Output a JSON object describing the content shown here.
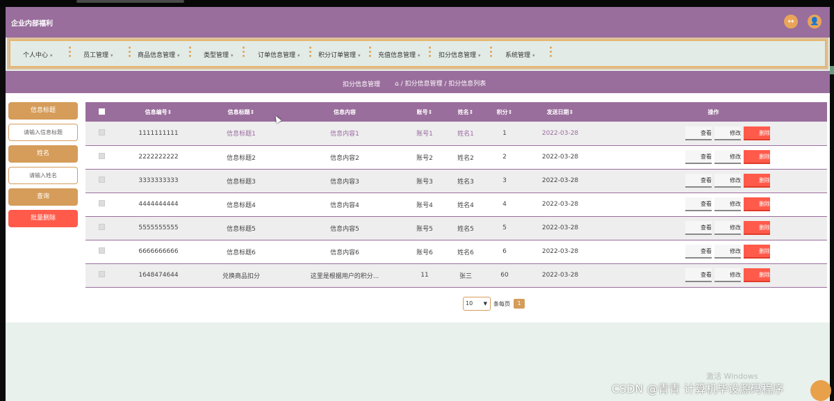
{
  "app": {
    "title": "企业内部福利"
  },
  "header_icons": {
    "expand": "↔",
    "user": "👤"
  },
  "nav": [
    {
      "label": "个人中心"
    },
    {
      "label": "员工管理"
    },
    {
      "label": "商品信息管理"
    },
    {
      "label": "类型管理"
    },
    {
      "label": "订单信息管理"
    },
    {
      "label": "积分订单管理"
    },
    {
      "label": "充值信息管理"
    },
    {
      "label": "扣分信息管理"
    },
    {
      "label": "系统管理"
    }
  ],
  "breadcrumb": {
    "current": "扣分信息管理",
    "trail": "⌂ / 扣分信息管理 / 扣分信息列表"
  },
  "search": {
    "title_label": "信息标题",
    "title_placeholder": "请输入信息标题",
    "name_label": "姓名",
    "name_placeholder": "请输入姓名",
    "query_button": "查询",
    "batch_delete_button": "批量删除"
  },
  "table": {
    "headers": [
      "信息编号⇕",
      "信息标题⇕",
      "信息内容",
      "账号⇕",
      "姓名⇕",
      "积分⇕",
      "发送日期⇕",
      "操作"
    ],
    "rows": [
      {
        "id": "1111111111",
        "title": "信息标题1",
        "content": "信息内容1",
        "account": "账号1",
        "name": "姓名1",
        "points": "1",
        "date": "2022-03-28"
      },
      {
        "id": "2222222222",
        "title": "信息标题2",
        "content": "信息内容2",
        "account": "账号2",
        "name": "姓名2",
        "points": "2",
        "date": "2022-03-28"
      },
      {
        "id": "3333333333",
        "title": "信息标题3",
        "content": "信息内容3",
        "account": "账号3",
        "name": "姓名3",
        "points": "3",
        "date": "2022-03-28"
      },
      {
        "id": "4444444444",
        "title": "信息标题4",
        "content": "信息内容4",
        "account": "账号4",
        "name": "姓名4",
        "points": "4",
        "date": "2022-03-28"
      },
      {
        "id": "5555555555",
        "title": "信息标题5",
        "content": "信息内容5",
        "account": "账号5",
        "name": "姓名5",
        "points": "5",
        "date": "2022-03-28"
      },
      {
        "id": "6666666666",
        "title": "信息标题6",
        "content": "信息内容6",
        "account": "账号6",
        "name": "姓名6",
        "points": "6",
        "date": "2022-03-28"
      },
      {
        "id": "1648474644",
        "title": "兑换商品扣分",
        "content": "这里是根据用户的积分...",
        "account": "11",
        "name": "张三",
        "points": "60",
        "date": "2022-03-28"
      }
    ],
    "actions": {
      "view": "查看",
      "edit": "修改",
      "delete": "删除"
    }
  },
  "pagination": {
    "page_size": "10",
    "per_page_label": "条每页",
    "current_page": "1"
  },
  "watermarks": {
    "windows": "激活 Windows",
    "csdn": "CSDN @青青  计算机毕设源码程序"
  }
}
